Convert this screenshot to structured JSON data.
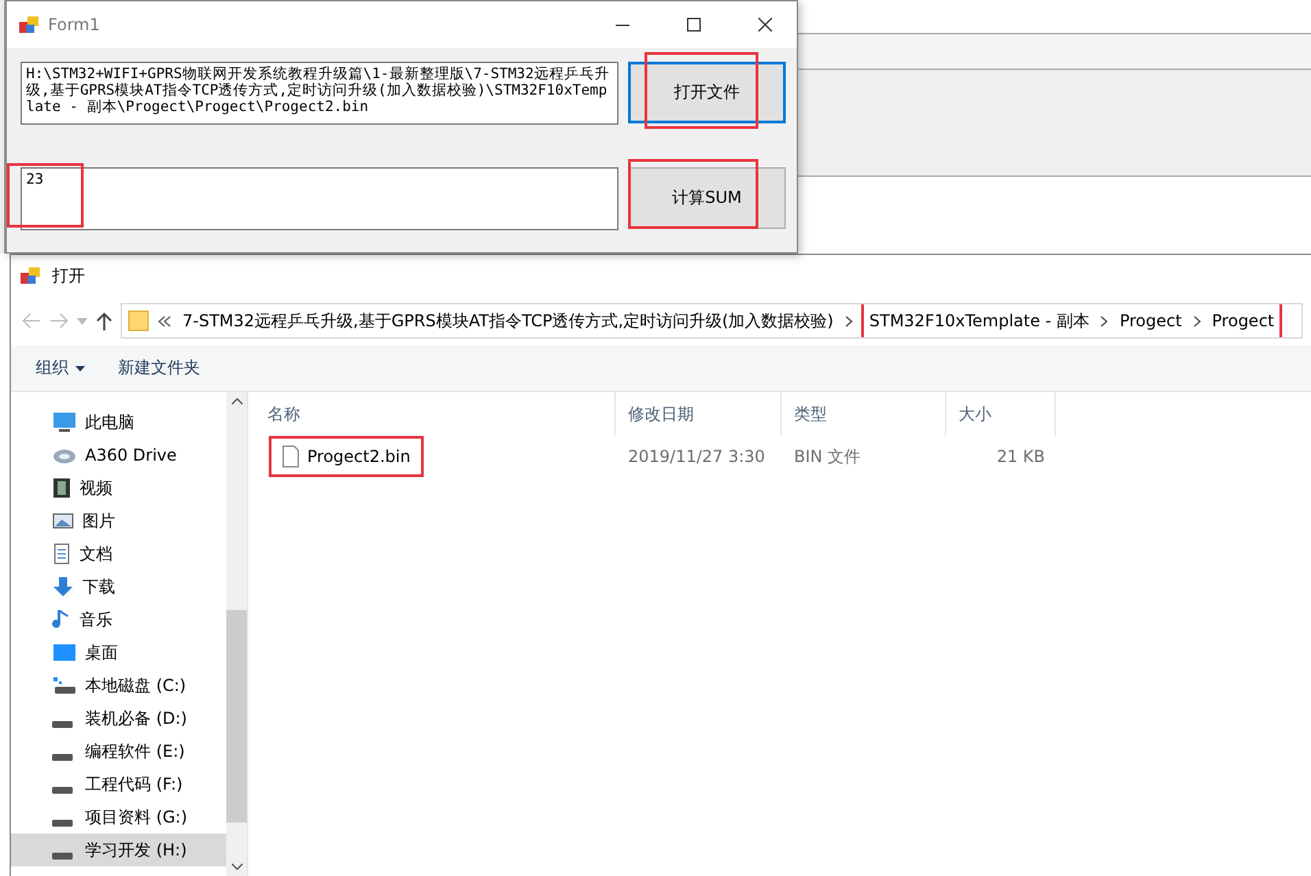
{
  "form": {
    "title": "Form1",
    "path_box": {
      "value": "H:\\STM32+WIFI+GPRS物联网开发系统教程升级篇\\1-最新整理版\\7-STM32远程乒乓升级,基于GPRS模块AT指令TCP透传方式,定时访问升级(加入数据校验)\\STM32F10xTemplate - 副本\\Progect\\Progect\\Progect2.bin"
    },
    "open_button": {
      "label": "打开文件",
      "focused": true,
      "highlighted": true
    },
    "sum_box": {
      "value": "23",
      "highlighted": true
    },
    "sum_button": {
      "label": "计算SUM",
      "focused": false,
      "highlighted": true
    }
  },
  "dialog": {
    "title": "打开",
    "breadcrumb": [
      {
        "label": "7-STM32远程乒乓升级,基于GPRS模块AT指令TCP透传方式,定时访问升级(加入数据校验)",
        "highlighted": false
      },
      {
        "label": "STM32F10xTemplate - 副本",
        "highlighted": true
      },
      {
        "label": "Progect",
        "highlighted": true
      },
      {
        "label": "Progect",
        "highlighted": true
      }
    ],
    "toolbar": [
      {
        "label": "组织",
        "kind": "menu"
      },
      {
        "label": "新建文件夹",
        "kind": "button"
      }
    ],
    "nav_items": [
      {
        "label": "此电脑",
        "kind": "pc",
        "selected": false
      },
      {
        "label": "A360 Drive",
        "kind": "cloud",
        "selected": false
      },
      {
        "label": "视频",
        "kind": "video",
        "selected": false
      },
      {
        "label": "图片",
        "kind": "picture",
        "selected": false
      },
      {
        "label": "文档",
        "kind": "document",
        "selected": false
      },
      {
        "label": "下载",
        "kind": "download",
        "selected": false
      },
      {
        "label": "音乐",
        "kind": "music",
        "selected": false
      },
      {
        "label": "桌面",
        "kind": "desktop",
        "selected": false
      },
      {
        "label": "本地磁盘 (C:)",
        "kind": "system-drive",
        "selected": false
      },
      {
        "label": "装机必备 (D:)",
        "kind": "drive",
        "selected": false
      },
      {
        "label": "编程软件 (E:)",
        "kind": "drive",
        "selected": false
      },
      {
        "label": "工程代码 (F:)",
        "kind": "drive",
        "selected": false
      },
      {
        "label": "项目资料 (G:)",
        "kind": "drive",
        "selected": false
      },
      {
        "label": "学习开发 (H:)",
        "kind": "drive",
        "selected": true
      }
    ],
    "columns": [
      "名称",
      "修改日期",
      "类型",
      "大小"
    ],
    "files": [
      {
        "name": "Progect2.bin",
        "modified": "2019/11/27 3:30",
        "type": "BIN 文件",
        "size": "21 KB",
        "highlighted": true
      }
    ]
  }
}
